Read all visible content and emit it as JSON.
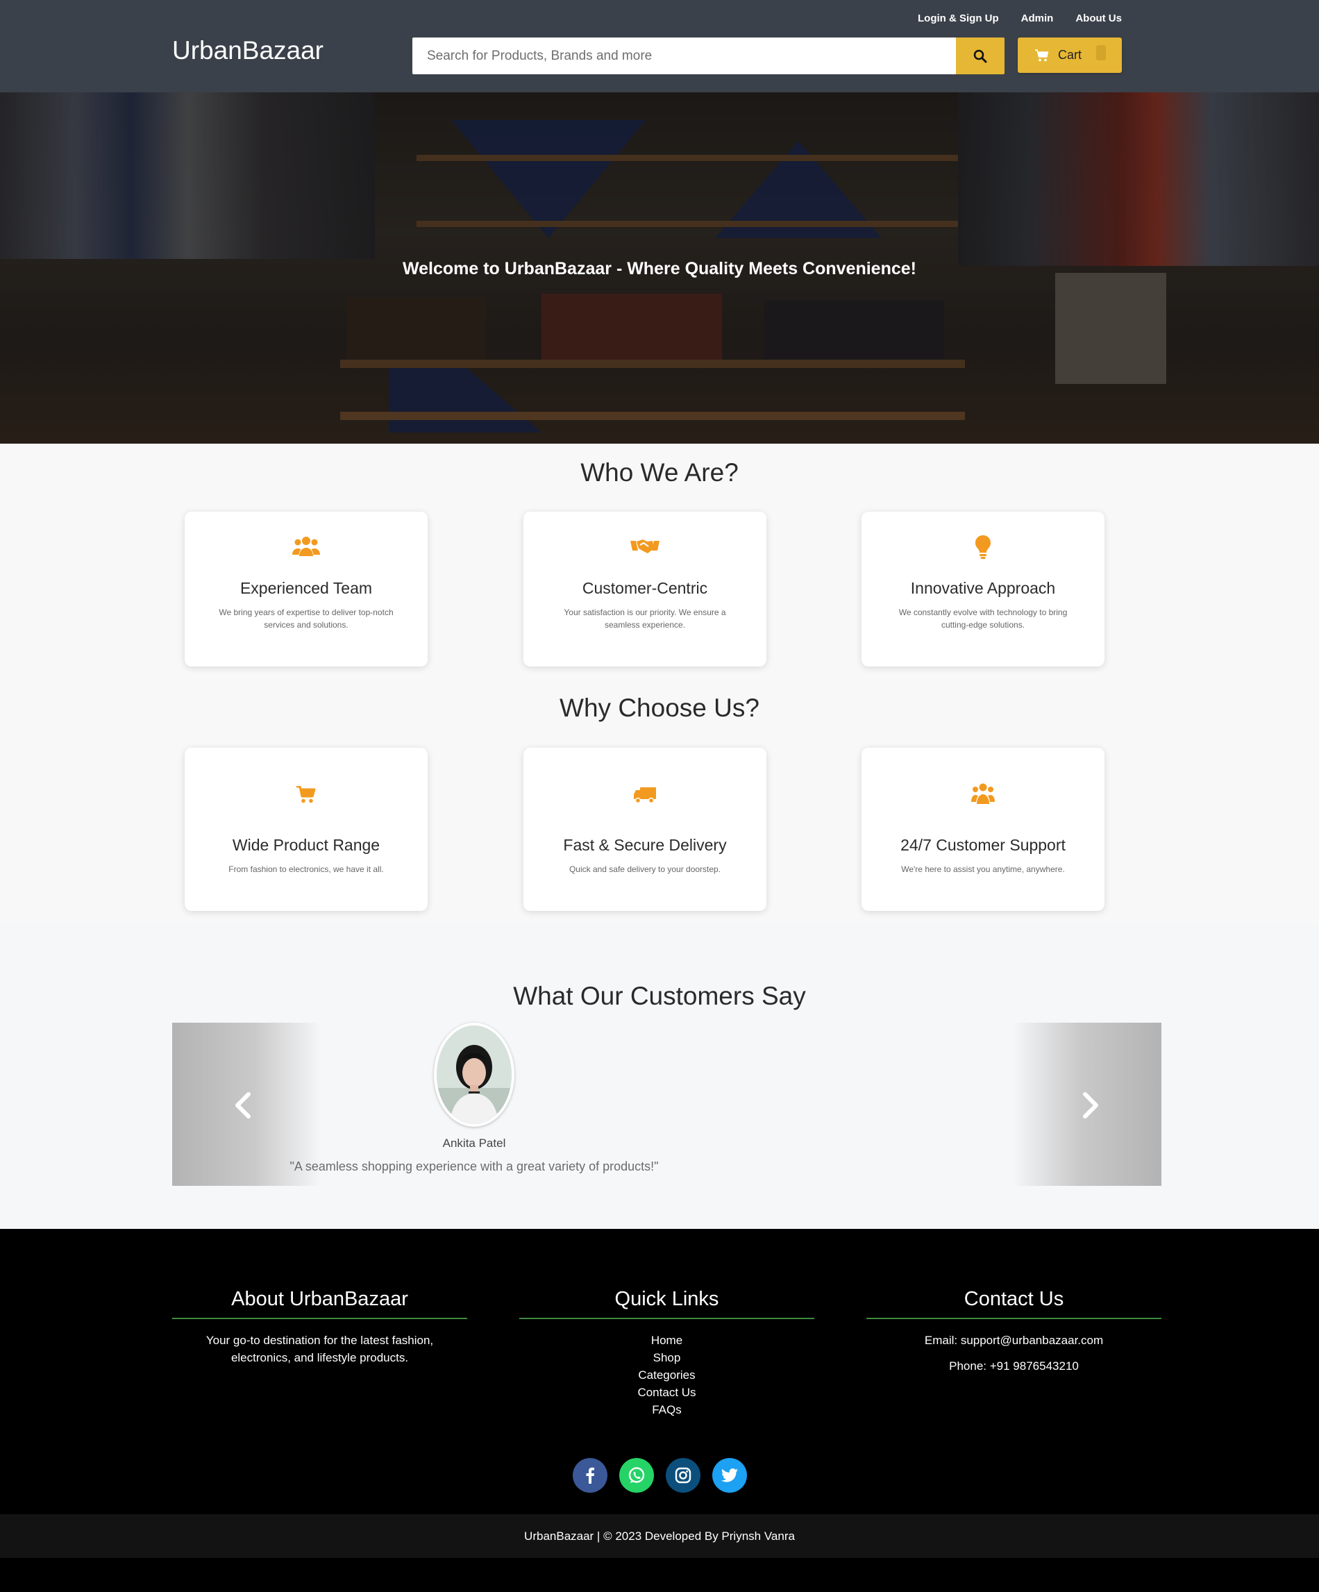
{
  "header": {
    "logo": "UrbanBazaar",
    "top_links": [
      "Login & Sign Up",
      "Admin",
      "About Us"
    ],
    "search_placeholder": "Search for Products, Brands and more",
    "cart_label": "Cart",
    "accent_color": "#e6b734",
    "bg_color": "#3b414a"
  },
  "hero": {
    "title": "Welcome to UrbanBazaar - Where Quality Meets Convenience!"
  },
  "who_we_are": {
    "title": "Who We Are?",
    "cards": [
      {
        "icon": "users-icon",
        "title": "Experienced Team",
        "text": "We bring years of expertise to deliver top-notch services and solutions."
      },
      {
        "icon": "handshake-icon",
        "title": "Customer-Centric",
        "text": "Your satisfaction is our priority. We ensure a seamless experience."
      },
      {
        "icon": "lightbulb-icon",
        "title": "Innovative Approach",
        "text": "We constantly evolve with technology to bring cutting-edge solutions."
      }
    ]
  },
  "why_choose_us": {
    "title": "Why Choose Us?",
    "cards": [
      {
        "icon": "cart-icon",
        "title": "Wide Product Range",
        "text": "From fashion to electronics, we have it all."
      },
      {
        "icon": "truck-icon",
        "title": "Fast & Secure Delivery",
        "text": "Quick and safe delivery to your doorstep."
      },
      {
        "icon": "support-icon",
        "title": "24/7 Customer Support",
        "text": "We're here to assist you anytime, anywhere."
      }
    ]
  },
  "testimonials": {
    "title": "What Our Customers Say",
    "name": "Ankita Patel",
    "quote": "\"A seamless shopping experience with a great variety of products!\""
  },
  "footer": {
    "about_title": "About UrbanBazaar",
    "about_text": "Your go-to destination for the latest fashion, electronics, and lifestyle products.",
    "links_title": "Quick Links",
    "links": [
      "Home",
      "Shop",
      "Categories",
      "Contact Us",
      "FAQs"
    ],
    "contact_title": "Contact Us",
    "email": "Email: support@urbanbazaar.com",
    "phone": "Phone: +91 9876543210",
    "socials": [
      "facebook-icon",
      "whatsapp-icon",
      "instagram-icon",
      "twitter-icon"
    ],
    "copyright": "UrbanBazaar | © 2023 Developed By Priynsh Vanra"
  },
  "icon_color": "#f29a1f"
}
